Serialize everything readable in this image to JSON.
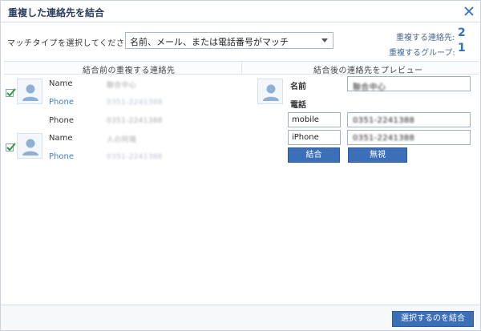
{
  "window": {
    "title": "重複した連絡先を結合"
  },
  "match": {
    "label": "マッチタイプを選択してください:",
    "selected": "名前、メール、または電話番号がマッチ"
  },
  "stats": {
    "duplicate_contacts_label": "重複する連絡先:",
    "duplicate_contacts_value": "2",
    "duplicate_groups_label": "重複するグループ:",
    "duplicate_groups_value": "1"
  },
  "columns": {
    "left_header": "結合前の重複する連絡先",
    "right_header": "結合後の連絡先をプレビュー"
  },
  "left": {
    "contacts": [
      {
        "name_key": "Name",
        "name_value": "聯合中心",
        "phones": [
          {
            "key": "Phone",
            "value": "0351-2241388"
          },
          {
            "key": "Phone",
            "value": "0351-2241388"
          }
        ]
      },
      {
        "name_key": "Name",
        "name_value": "人の阿場",
        "phones": [
          {
            "key": "Phone",
            "value": "0351-2241388"
          }
        ]
      }
    ]
  },
  "preview": {
    "name_label": "名前",
    "name_value": "聯合中心",
    "phone_label": "電話",
    "phones": [
      {
        "type": "mobile",
        "value": "0351-2241388"
      },
      {
        "type": "iPhone",
        "value": "0351-2241388"
      }
    ],
    "merge_label": "結合",
    "ignore_label": "無視"
  },
  "footer": {
    "merge_selected_label": "選択するのを結合"
  },
  "colors": {
    "accent": "#2f6fc4",
    "button": "#3b6fb8"
  },
  "icons": [
    "close-icon",
    "dropdown-caret-icon",
    "checkbox-checked-icon",
    "avatar-person-icon"
  ]
}
